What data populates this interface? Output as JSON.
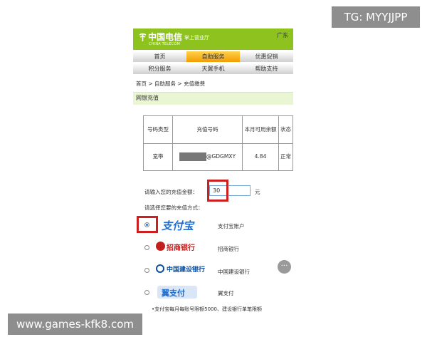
{
  "watermarks": {
    "tg": "TG: MYYJJPP",
    "site": "www.games-kfk8.com"
  },
  "header": {
    "logo_cn": "中国电信",
    "logo_en": "CHINA TELECOM",
    "logo_sub": "掌上营业厅",
    "region": "广东",
    "brand_color": "#8dc21f"
  },
  "nav": {
    "row1": [
      {
        "label": "首页",
        "active": false
      },
      {
        "label": "自助服务",
        "active": true
      },
      {
        "label": "优惠促销",
        "active": false
      }
    ],
    "row2": [
      {
        "label": "积分服务",
        "active": false
      },
      {
        "label": "天翼手机",
        "active": false
      },
      {
        "label": "帮助支持",
        "active": false
      }
    ]
  },
  "breadcrumb": "首页 > 自助服务 > 充值缴费",
  "section_title": "网银充值",
  "table": {
    "headers": [
      "号码类型",
      "充值号码",
      "本月可用余额",
      "状态"
    ],
    "row": {
      "type": "宽带",
      "number_suffix": "@GDGMXY",
      "balance": "4.84",
      "status": "正常"
    }
  },
  "amount": {
    "label": "请输入您的充值金额：",
    "value": "30",
    "unit": "元"
  },
  "payment": {
    "label": "请选择您要的充值方式：",
    "methods": [
      {
        "logo": "支付宝",
        "name": "支付宝账户",
        "checked": true,
        "color": "#1e6fd0"
      },
      {
        "logo": "招商银行",
        "name": "招商银行",
        "checked": false,
        "color": "#c41f1f"
      },
      {
        "logo": "中国建设银行",
        "name": "中国建设银行",
        "checked": false,
        "color": "#0a4fa3"
      },
      {
        "logo": "翼支付",
        "name": "翼支付",
        "checked": false,
        "color": "#1e6fd0"
      }
    ]
  },
  "more_button": "···",
  "footnote": "•支付宝每月每账号限额5000、建设银行单笔限额"
}
